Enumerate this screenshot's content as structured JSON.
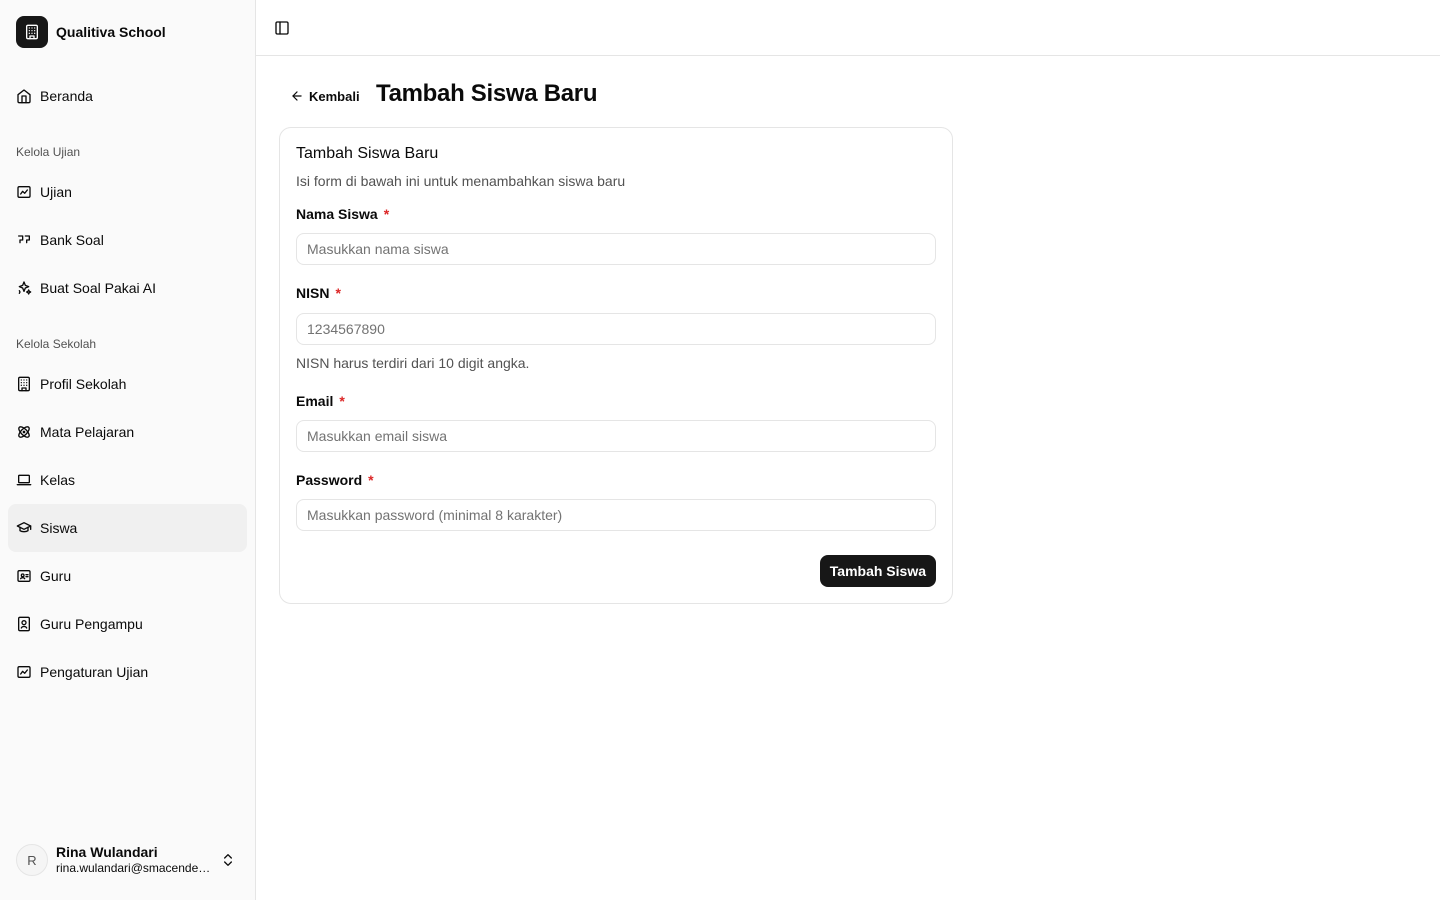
{
  "app": {
    "school_name": "Qualitiva School",
    "logo_icon": "building-icon"
  },
  "sidebar": {
    "home": {
      "label": "Beranda",
      "icon": "home-icon"
    },
    "groups": [
      {
        "label": "Kelola Ujian"
      },
      {
        "label": "Kelola Sekolah"
      }
    ],
    "exam_items": [
      {
        "label": "Ujian",
        "icon": "image-chart-icon"
      },
      {
        "label": "Bank Soal",
        "icon": "quote-icon"
      },
      {
        "label": "Buat Soal Pakai AI",
        "icon": "sparkles-icon"
      }
    ],
    "school_items": [
      {
        "label": "Profil Sekolah",
        "icon": "building-icon"
      },
      {
        "label": "Mata Pelajaran",
        "icon": "atom-icon"
      },
      {
        "label": "Kelas",
        "icon": "laptop-icon"
      },
      {
        "label": "Siswa",
        "icon": "graduation-cap-icon",
        "active": true
      },
      {
        "label": "Guru",
        "icon": "id-card-icon"
      },
      {
        "label": "Guru Pengampu",
        "icon": "contact-badge-icon"
      },
      {
        "label": "Pengaturan Ujian",
        "icon": "image-chart-icon"
      }
    ],
    "user": {
      "initial": "R",
      "name": "Rina Wulandari",
      "email": "rina.wulandari@smacendekia.sch.id"
    }
  },
  "header": {
    "back_label": "Kembali",
    "page_title": "Tambah Siswa Baru"
  },
  "form": {
    "title": "Tambah Siswa Baru",
    "description": "Isi form di bawah ini untuk menambahkan siswa baru",
    "required_mark": "*",
    "fields": {
      "name": {
        "label": "Nama Siswa",
        "placeholder": "Masukkan nama siswa",
        "value": ""
      },
      "nisn": {
        "label": "NISN",
        "placeholder": "1234567890",
        "value": "",
        "hint": "NISN harus terdiri dari 10 digit angka."
      },
      "email": {
        "label": "Email",
        "placeholder": "Masukkan email siswa",
        "value": ""
      },
      "password": {
        "label": "Password",
        "placeholder": "Masukkan password (minimal 8 karakter)",
        "value": ""
      }
    },
    "submit_label": "Tambah Siswa"
  },
  "colors": {
    "primary": "#171717",
    "required": "#dc2626",
    "sidebar_bg": "#fafafa",
    "active_bg": "#f0f0f0",
    "border": "#e5e5e5"
  }
}
